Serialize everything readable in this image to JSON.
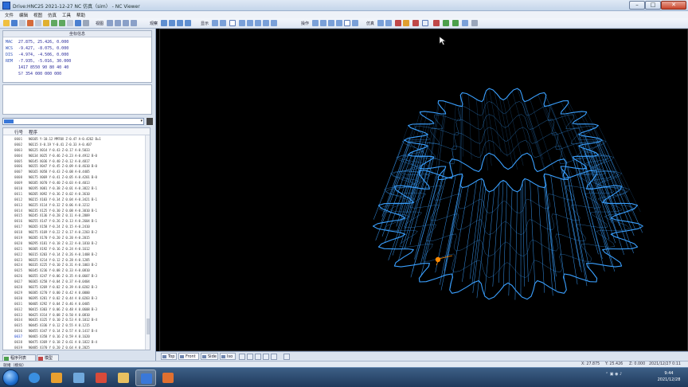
{
  "window": {
    "title": "Drive:HNC25  2021-12-27  NC  仿真（sim） - NC Viewer"
  },
  "menu": [
    "文件",
    "编辑",
    "视图",
    "仿真",
    "工具",
    "帮助"
  ],
  "toolbar": {
    "groups": [
      "视图",
      "观察",
      "显示",
      "操作",
      "仿真"
    ]
  },
  "coords": {
    "header": "坐标信息",
    "rows": [
      {
        "label": "MAC",
        "values": "27.875,  25.426,   0.000"
      },
      {
        "label": "WCS",
        "values": "-9.427,  -8.075,   0.000"
      },
      {
        "label": "DIS",
        "values": "-4.974,  -4.506,   0.000"
      },
      {
        "label": "REM",
        "values": "-7.935,  -5.016,  30.000"
      },
      {
        "label": "",
        "values": "1417  8550  90 80 40 40"
      },
      {
        "label": "",
        "values": "S?  354 000 000 000"
      }
    ]
  },
  "program_list": {
    "columns": [
      "行号",
      "程序"
    ],
    "rows": [
      {
        "line": "0001",
        "code": "N0105 Y-10.12 MM70X Z-0.47 A-0.4262 B=1"
      },
      {
        "line": "0002",
        "code": "N0115 X-0.19 Y-0.41 Z-0.33 A-0.407"
      },
      {
        "line": "0003",
        "code": "N0125 X014 Y-0.43 Z-0.17 A-0.5033"
      },
      {
        "line": "0004",
        "code": "N0134 X025 Y-0.46 Z-0.23 A-0.4912 B-0"
      },
      {
        "line": "0005",
        "code": "N0145 X036 Y-0.40 Z-0.12 A-0.4817"
      },
      {
        "line": "0006",
        "code": "N0155 X047 Y-0.45 Z-0.09 A-0.4610 B-0"
      },
      {
        "line": "0007",
        "code": "N0165 X058 Y-0.43 Z-0.08 A-0.4405"
      },
      {
        "line": "0008",
        "code": "N0175 X069 Y-0.41 Z-0.05 A-0.4201 B-0"
      },
      {
        "line": "0009",
        "code": "N0185 X070 Y-0.40 Z-0.03 A-0.4013"
      },
      {
        "line": "0010",
        "code": "N0195 X081 Y-0.38 Z-0.01 A-0.3822 B-1"
      },
      {
        "line": "0011",
        "code": "N0205 X092 Y-0.36 Z 0.02 A-0.3610"
      },
      {
        "line": "0012",
        "code": "N0215 X103 Y-0.34 Z 0.04 A-0.3421 B-1"
      },
      {
        "line": "0013",
        "code": "N0225 X114 Y-0.32 Z 0.06 A-0.3212"
      },
      {
        "line": "0014",
        "code": "N0235 X125 Y-0.30 Z 0.08 A-0.3010 B-1"
      },
      {
        "line": "0015",
        "code": "N0245 X136 Y-0.28 Z 0.11 A-0.2809"
      },
      {
        "line": "0016",
        "code": "N0255 X147 Y-0.26 Z 0.13 A-0.2604 B-1"
      },
      {
        "line": "0017",
        "code": "N0265 X158 Y-0.24 Z 0.15 A-0.2410"
      },
      {
        "line": "0018",
        "code": "N0275 X169 Y-0.22 Z 0.17 A-0.2203 B-2"
      },
      {
        "line": "0019",
        "code": "N0285 X170 Y-0.20 Z 0.20 A-0.2015"
      },
      {
        "line": "0020",
        "code": "N0295 X181 Y-0.18 Z 0.22 A-0.1810 B-2"
      },
      {
        "line": "0021",
        "code": "N0305 X192 Y-0.16 Z 0.24 A-0.1612"
      },
      {
        "line": "0022",
        "code": "N0315 X203 Y-0.14 Z 0.26 A-0.1408 B-2"
      },
      {
        "line": "0023",
        "code": "N0325 X214 Y-0.12 Z 0.28 A-0.1205"
      },
      {
        "line": "0024",
        "code": "N0335 X225 Y-0.10 Z 0.31 A-0.1003 B-2"
      },
      {
        "line": "0025",
        "code": "N0345 X236 Y-0.08 Z 0.33 A-0.0810"
      },
      {
        "line": "0026",
        "code": "N0355 X247 Y-0.06 Z 0.35 A-0.0607 B-3"
      },
      {
        "line": "0027",
        "code": "N0365 X258 Y-0.04 Z 0.37 A-0.0404"
      },
      {
        "line": "0028",
        "code": "N0375 X269 Y-0.02 Z 0.39 A-0.0202 B-3"
      },
      {
        "line": "0029",
        "code": "N0385 X270 Y 0.00 Z 0.42 A 0.0000"
      },
      {
        "line": "0030",
        "code": "N0395 X281 Y 0.02 Z 0.44 A 0.0203 B-3"
      },
      {
        "line": "0031",
        "code": "N0405 X292 Y 0.04 Z 0.46 A 0.0405"
      },
      {
        "line": "0032",
        "code": "N0415 X303 Y 0.06 Z 0.48 A 0.0608 B-3"
      },
      {
        "line": "0033",
        "code": "N0425 X314 Y 0.08 Z 0.50 A 0.0810"
      },
      {
        "line": "0034",
        "code": "N0435 X325 Y 0.10 Z 0.53 A 0.1012 B-4"
      },
      {
        "line": "0035",
        "code": "N0445 X336 Y 0.12 Z 0.55 A 0.1215"
      },
      {
        "line": "0036",
        "code": "N0455 X347 Y 0.14 Z 0.57 A 0.1417 B-4"
      },
      {
        "line": "0037",
        "code": "N0465 X358 Y 0.16 Z 0.59 A 0.1620"
      },
      {
        "line": "0038",
        "code": "N0475 X369 Y 0.18 Z 0.61 A 0.1822 B-4"
      },
      {
        "line": "0039",
        "code": "N0485 X370 Y 0.20 Z 0.64 A 0.2025"
      },
      {
        "line": "0040",
        "code": "N0495 X381 Y 0.22 Z 0.66 A 0.2227 B-4"
      }
    ]
  },
  "left_tabs": [
    "程序列表",
    "模型"
  ],
  "view_tabs": [
    "Top",
    "Front",
    "Side",
    "Iso"
  ],
  "status": {
    "left": "就绪（模拟）",
    "x": "X: 27.875",
    "y": "Y: 25.426",
    "z": "Z: 0.000",
    "right": "2021/12/27  0:11"
  },
  "taskbar": {
    "time": "9:44",
    "date": "2021/12/28"
  },
  "colors": {
    "gear": "#3aa0ff",
    "cursor_marker": "#ff8a00"
  }
}
